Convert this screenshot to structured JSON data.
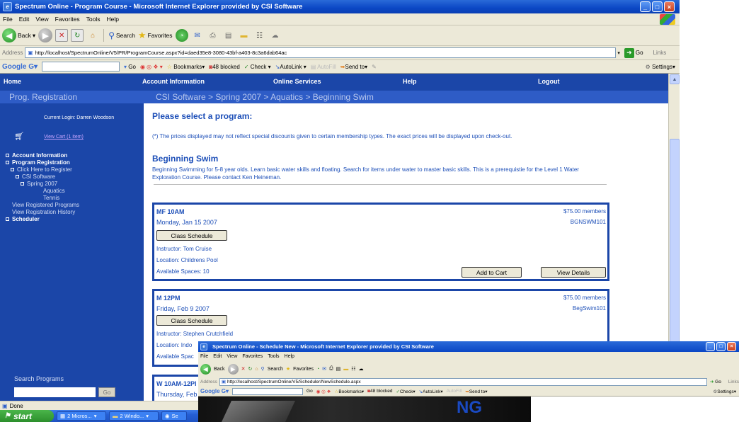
{
  "window": {
    "title": "Spectrum Online - Program Course - Microsoft Internet Explorer provided by CSI Software"
  },
  "menu": [
    "File",
    "Edit",
    "View",
    "Favorites",
    "Tools",
    "Help"
  ],
  "toolbar": {
    "back": "Back",
    "search": "Search",
    "favorites": "Favorites"
  },
  "address": {
    "label": "Address",
    "url": "http://localhost/SpectrumOnline/V5/PR/ProgramCourse.aspx?id=daed35e8-3080-43bf-a403-8c3a6dab64ac",
    "go": "Go",
    "links": "Links"
  },
  "googlebar": {
    "logo": "Google",
    "go": "Go",
    "bookmarks": "Bookmarks",
    "blocked": "48 blocked",
    "check": "Check",
    "autolink": "AutoLink",
    "autofill": "AutoFill",
    "sendto": "Send to",
    "settings": "Settings"
  },
  "topnav": {
    "home": "Home",
    "account": "Account Information",
    "online": "Online Services",
    "help": "Help",
    "logout": "Logout"
  },
  "sidebar": {
    "header": "Prog. Registration",
    "current_login": "Current Login: Darren Woodson",
    "view_cart": "View Cart (1 item)",
    "items": [
      "Account Information",
      "Program Registration",
      "Click Here to Register",
      "CSI Software",
      "Spring 2007",
      "Aquatics",
      "Tennis",
      "View Registered Programs",
      "View Registration History",
      "Scheduler"
    ],
    "search_label": "Search Programs",
    "search_go": "Go"
  },
  "breadcrumb": "CSI Software > Spring 2007 > Aquatics > Beginning Swim",
  "page": {
    "select_heading": "Please select a program:",
    "price_note": "(*) The prices displayed may not reflect special discounts given to certain membership types. The exact prices will be displayed upon check-out.",
    "program_title": "Beginning Swim",
    "program_desc": "Beginning Swimming for 5-8 year olds. Learn basic water skills and floating. Search for items under water to master basic skills. This is a prerequistie for the Level 1 Water Exploration Course. Please contact Ken Heineman."
  },
  "sessions": [
    {
      "time": "MF 10AM",
      "date": "Monday, Jan 15 2007",
      "price": "$75.00 members",
      "code": "BGNSWM101",
      "schedule_btn": "Class Schedule",
      "instructor": "Instructor:  Tom Cruise",
      "location": "Location:  Childrens Pool",
      "spaces": "Available Spaces:  10",
      "add_btn": "Add to Cart",
      "details_btn": "View Details"
    },
    {
      "time": "M 12PM",
      "date": "Friday, Feb 9 2007",
      "price": "$75.00 members",
      "code": "BegSwim101",
      "schedule_btn": "Class Schedule",
      "instructor": "Instructor:  Stephen Crutchfield",
      "location": "Location:  Indo",
      "spaces": "Available Spac"
    },
    {
      "time": "W 10AM-12PI",
      "date": "Thursday, Feb"
    }
  ],
  "status": "Done",
  "taskbar": {
    "start": "start",
    "tasks": [
      "2 Micros...",
      "2 Windo...",
      "Se"
    ]
  },
  "popup": {
    "title": "Spectrum Online - Schedule New - Microsoft Internet Explorer provided by CSI Software",
    "menu": [
      "File",
      "Edit",
      "View",
      "Favorites",
      "Tools",
      "Help"
    ],
    "url": "http://localhost/SpectrumOnline/V5/Scheduler/NewSchedule.aspx",
    "banner_text": "NG"
  },
  "colors": {
    "nav_blue": "#1b46a8",
    "header_blue": "#2e5cc6",
    "link_blue": "#1d4fb8"
  }
}
